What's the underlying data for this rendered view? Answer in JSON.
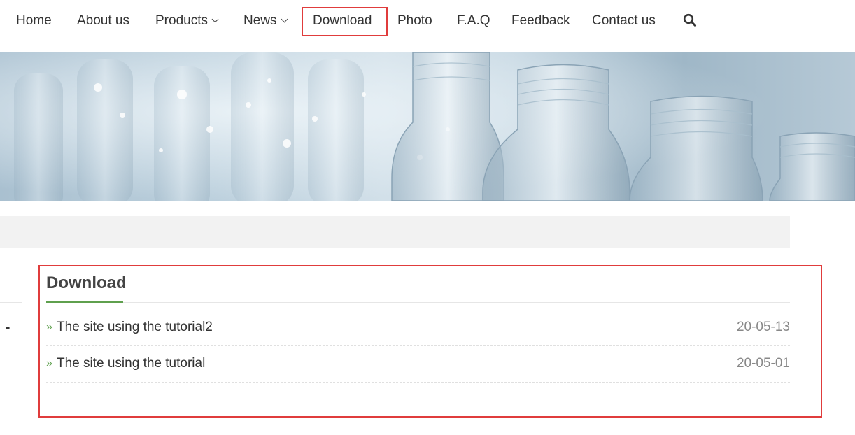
{
  "nav": {
    "items": [
      {
        "label": "Home",
        "dropdown": false
      },
      {
        "label": "About us",
        "dropdown": false
      },
      {
        "label": "Products",
        "dropdown": true
      },
      {
        "label": "News",
        "dropdown": true
      },
      {
        "label": "Download",
        "dropdown": false,
        "active": true
      },
      {
        "label": "Photo",
        "dropdown": false
      },
      {
        "label": "F.A.Q",
        "dropdown": false
      },
      {
        "label": "Feedback",
        "dropdown": false
      },
      {
        "label": "Contact us",
        "dropdown": false
      }
    ],
    "search_icon": "search-icon"
  },
  "banner": {
    "image": "plastic-bottles-banner"
  },
  "sidebar": {
    "dash": "-"
  },
  "content": {
    "title": "Download",
    "items": [
      {
        "label": "The site using the tutorial2",
        "date": "20-05-13",
        "bullet": "»"
      },
      {
        "label": "The site using the tutorial",
        "date": "20-05-01",
        "bullet": "»"
      }
    ]
  },
  "colors": {
    "highlight": "#e03c3c",
    "accent": "#5fa04e",
    "text": "#333333",
    "muted": "#888888",
    "strip": "#f2f2f2"
  }
}
